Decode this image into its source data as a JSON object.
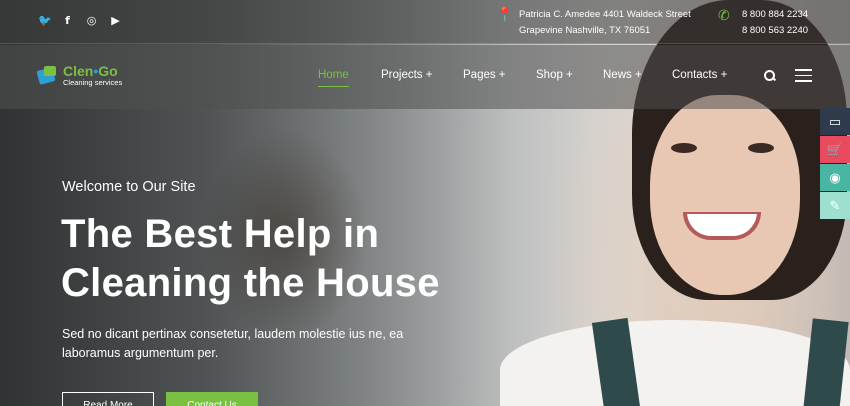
{
  "topbar": {
    "social_icons": [
      "twitter-icon",
      "facebook-icon",
      "instagram-icon",
      "youtube-icon"
    ],
    "address_line1": "Patricia C. Amedee 4401 Waldeck Street",
    "address_line2": "Grapevine Nashville, TX 76051",
    "phone1": "8 800 884 2234",
    "phone2": "8 800 563 2240"
  },
  "brand": {
    "name_part1": "Clen",
    "name_dot": "•",
    "name_part2": "Go",
    "tagline": "Cleaning services"
  },
  "nav": {
    "items": [
      {
        "label": "Home",
        "active": true
      },
      {
        "label": "Projects +"
      },
      {
        "label": "Pages +"
      },
      {
        "label": "Shop +"
      },
      {
        "label": "News +"
      },
      {
        "label": "Contacts +"
      }
    ]
  },
  "side_tools": [
    "monitor-icon",
    "cart-icon",
    "lifebuoy-icon",
    "edit-icon"
  ],
  "hero": {
    "welcome": "Welcome to Our Site",
    "headline_line1": "The Best Help in",
    "headline_line2": "Cleaning the House",
    "description": "Sed no dicant pertinax consetetur, laudem molestie ius ne, ea laboramus argumentum per.",
    "read_more": "Read More",
    "contact_us": "Contact Us"
  },
  "colors": {
    "accent_green": "#79c043",
    "accent_blue": "#2f9fd8"
  }
}
